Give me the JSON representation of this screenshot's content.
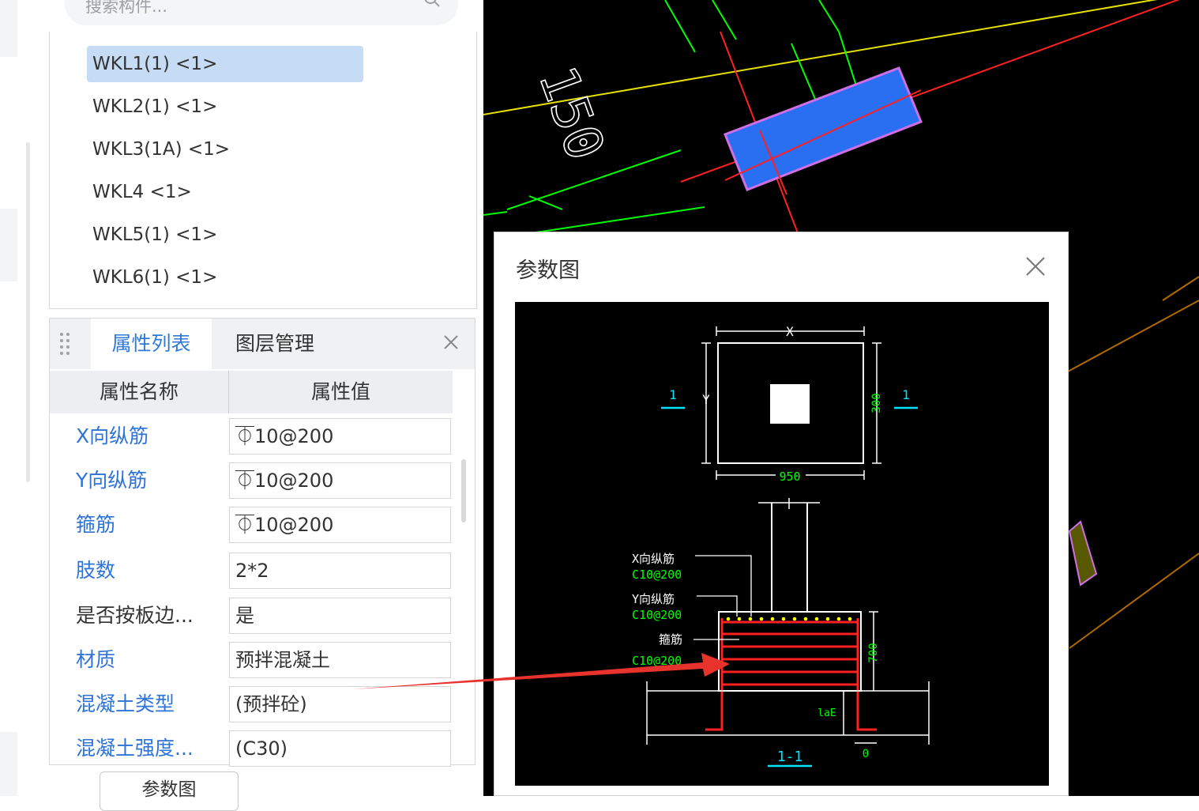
{
  "search": {
    "placeholder": "搜索构件..."
  },
  "tree": {
    "items": [
      {
        "label": "WKL1(1) <1>",
        "selected": true
      },
      {
        "label": "WKL2(1) <1>"
      },
      {
        "label": "WKL3(1A) <1>"
      },
      {
        "label": "WKL4 <1>"
      },
      {
        "label": "WKL5(1) <1>"
      },
      {
        "label": "WKL6(1) <1>"
      }
    ]
  },
  "props_panel": {
    "tabs": [
      {
        "label": "属性列表",
        "active": true
      },
      {
        "label": "图层管理"
      }
    ],
    "header": {
      "name": "属性名称",
      "value": "属性值"
    },
    "rows": [
      {
        "name": "X向纵筋",
        "value": "⏁10@200",
        "name_color": "blue"
      },
      {
        "name": "Y向纵筋",
        "value": "⏁10@200",
        "name_color": "blue"
      },
      {
        "name": "箍筋",
        "value": "⏁10@200",
        "name_color": "blue"
      },
      {
        "name": "肢数",
        "value": "2*2",
        "name_color": "blue"
      },
      {
        "name": "是否按板边...",
        "value": "是",
        "name_color": "black"
      },
      {
        "name": "材质",
        "value": "预拌混凝土",
        "name_color": "blue"
      },
      {
        "name": "混凝土类型",
        "value": "(预拌砼)",
        "name_color": "blue"
      },
      {
        "name": "混凝土强度...",
        "value": "(C30)",
        "name_color": "blue"
      }
    ],
    "button_label": "参数图"
  },
  "canvas": {
    "dimension_text": "150"
  },
  "dialog": {
    "title": "参数图",
    "drawing": {
      "x_label": "X",
      "y_label": "Y",
      "section_mark": "1",
      "dim_300": "300",
      "dim_950": "950",
      "dim_700": "700",
      "lae_label": "laE",
      "zero_label": "0",
      "section_title": "1-1",
      "x_bar_label": "X向纵筋",
      "x_bar_value": "C10@200",
      "y_bar_label": "Y向纵筋",
      "y_bar_value": "C10@200",
      "stirrup_label": "箍筋",
      "stirrup_value": "C10@200"
    }
  },
  "colors": {
    "accent": "#2f7ad8",
    "selected_item": "#c5dcf4",
    "annotation_arrow": "#e8322c",
    "cad_green": "#00ff00",
    "cad_cyan": "#00e5ff",
    "cad_red": "#ff2020",
    "cad_yellow": "#ffff00",
    "cad_blue_fill": "#2a6ef2"
  }
}
